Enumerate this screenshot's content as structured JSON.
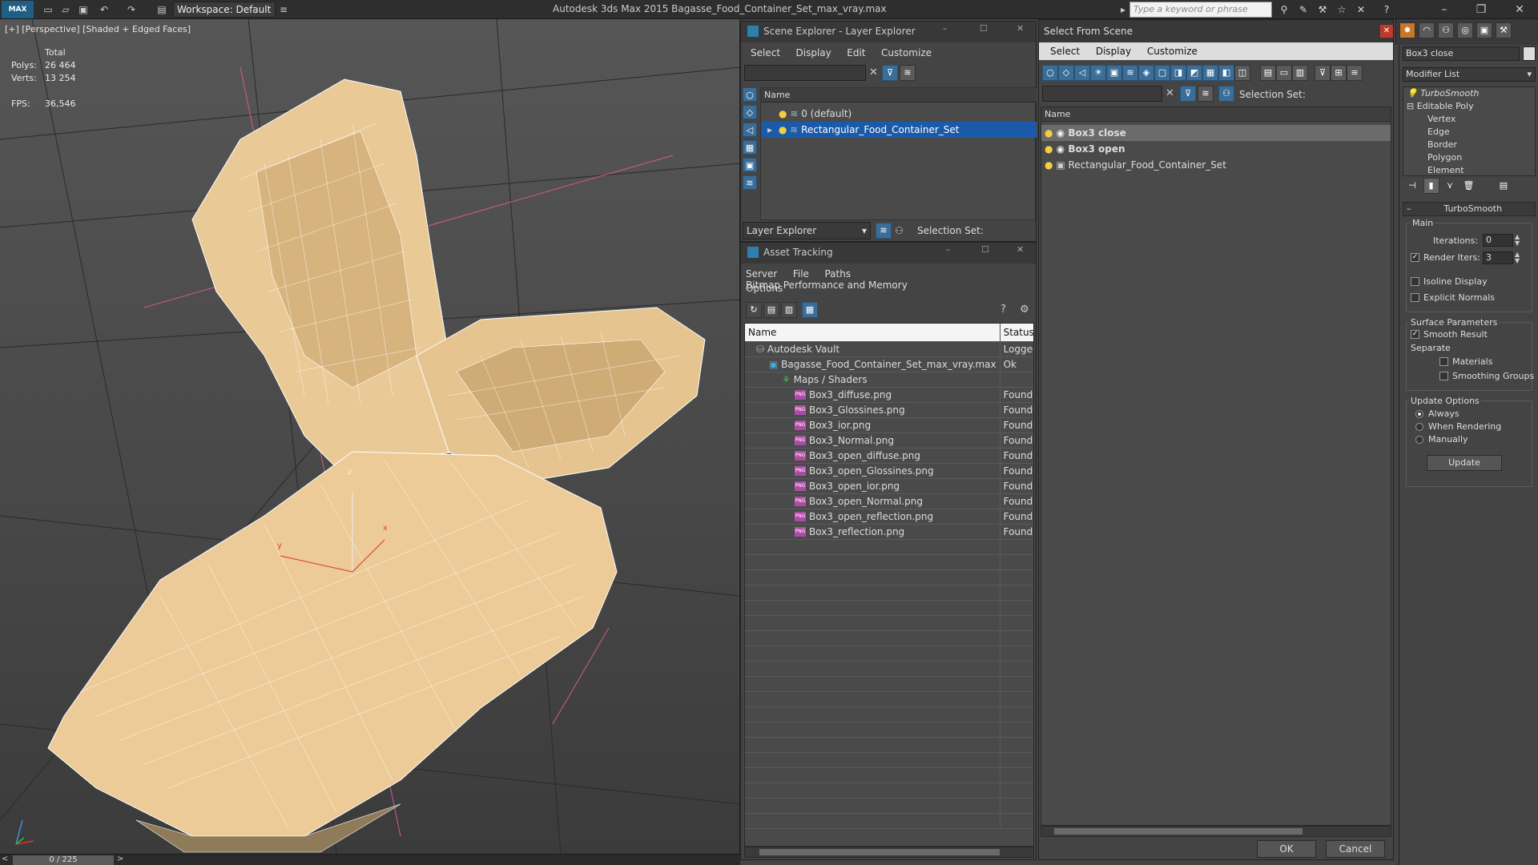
{
  "app": {
    "logo": "MAX",
    "workspace": "Workspace: Default",
    "title": "Autodesk 3ds Max  2015     Bagasse_Food_Container_Set_max_vray.max",
    "search_placeholder": "Type a keyword or phrase"
  },
  "viewport": {
    "label": "[+] [Perspective] [Shaded + Edged Faces]",
    "stats_total": "Total",
    "polys_label": "Polys:",
    "polys_value": "26 464",
    "verts_label": "Verts:",
    "verts_value": "13 254",
    "fps_label": "FPS:",
    "fps_value": "36,546",
    "axis_x": "x",
    "axis_y": "y",
    "axis_z": "z"
  },
  "timeline": {
    "frame": "0 / 225",
    "prev": "<",
    "next": ">"
  },
  "scene_explorer": {
    "title": "Scene Explorer - Layer Explorer",
    "menu": [
      "Select",
      "Display",
      "Edit",
      "Customize"
    ],
    "column_name": "Name",
    "layers": [
      "0 (default)",
      "Rectangular_Food_Container_Set"
    ],
    "footer_dropdown": "Layer Explorer",
    "selection_set_label": "Selection Set:"
  },
  "asset_tracking": {
    "title": "Asset Tracking",
    "menu": [
      "Server",
      "File",
      "Paths",
      "Bitmap Performance and Memory"
    ],
    "menu2": "Options",
    "col_name": "Name",
    "col_status": "Status",
    "rows": [
      {
        "name": "Autodesk Vault",
        "status": "Logged",
        "indent": 0
      },
      {
        "name": "Bagasse_Food_Container_Set_max_vray.max",
        "status": "Ok",
        "indent": 1
      },
      {
        "name": "Maps / Shaders",
        "status": "",
        "indent": 2
      },
      {
        "name": "Box3_diffuse.png",
        "status": "Found",
        "indent": 3
      },
      {
        "name": "Box3_Glossines.png",
        "status": "Found",
        "indent": 3
      },
      {
        "name": "Box3_ior.png",
        "status": "Found",
        "indent": 3
      },
      {
        "name": "Box3_Normal.png",
        "status": "Found",
        "indent": 3
      },
      {
        "name": "Box3_open_diffuse.png",
        "status": "Found",
        "indent": 3
      },
      {
        "name": "Box3_open_Glossines.png",
        "status": "Found",
        "indent": 3
      },
      {
        "name": "Box3_open_ior.png",
        "status": "Found",
        "indent": 3
      },
      {
        "name": "Box3_open_Normal.png",
        "status": "Found",
        "indent": 3
      },
      {
        "name": "Box3_open_reflection.png",
        "status": "Found",
        "indent": 3
      },
      {
        "name": "Box3_reflection.png",
        "status": "Found",
        "indent": 3
      }
    ],
    "png_icon": "PNG"
  },
  "select_from_scene": {
    "title": "Select From Scene",
    "menu": [
      "Select",
      "Display",
      "Customize"
    ],
    "selection_set_label": "Selection Set:",
    "column_name": "Name",
    "objects": [
      "Box3 close",
      "Box3 open",
      "Rectangular_Food_Container_Set"
    ],
    "ok": "OK",
    "cancel": "Cancel"
  },
  "command_panel": {
    "object_name": "Box3 close",
    "modifier_list": "Modifier List",
    "stack": [
      "TurboSmooth",
      "Editable Poly",
      "Vertex",
      "Edge",
      "Border",
      "Polygon",
      "Element"
    ],
    "rollout_title": "TurboSmooth",
    "main_label": "Main",
    "iterations_label": "Iterations:",
    "iterations_value": "0",
    "render_iters_label": "Render Iters:",
    "render_iters_value": "3",
    "isoline": "Isoline Display",
    "explicit_normals": "Explicit Normals",
    "surface_params": "Surface Parameters",
    "smooth_result": "Smooth Result",
    "separate": "Separate",
    "materials": "Materials",
    "smoothing_groups": "Smoothing Groups",
    "update_options": "Update Options",
    "always": "Always",
    "when_rendering": "When Rendering",
    "manually": "Manually",
    "update_btn": "Update"
  }
}
